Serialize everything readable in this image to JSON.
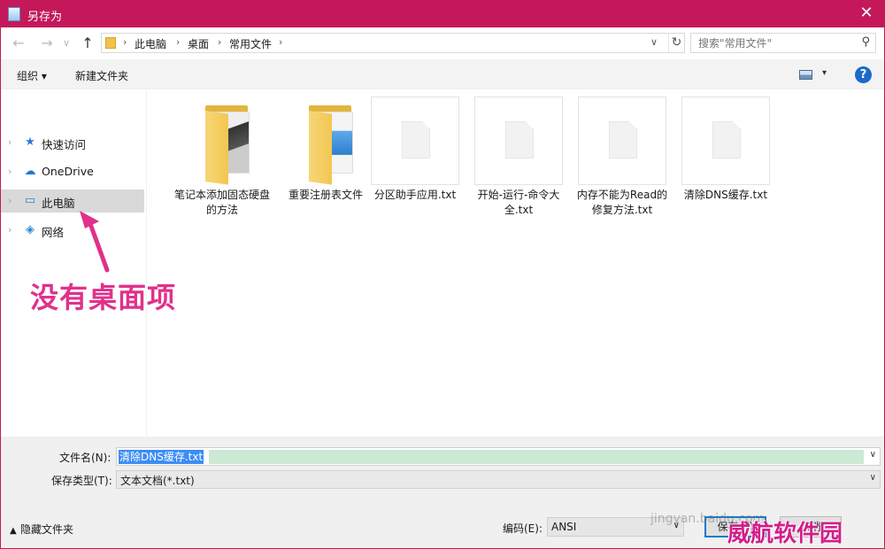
{
  "window": {
    "title": "另存为",
    "close_glyph": "✕"
  },
  "nav": {
    "back_glyph": "←",
    "forward_glyph": "→",
    "recent_glyph": "∨",
    "up_glyph": "↑",
    "breadcrumbs": [
      "此电脑",
      "桌面",
      "常用文件"
    ],
    "sep_glyph": "›",
    "dropdown_glyph": "∨",
    "refresh_glyph": "↻",
    "search_placeholder": "搜索\"常用文件\"",
    "search_glyph": "⚲"
  },
  "commandbar": {
    "organize": "组织 ▾",
    "new_folder": "新建文件夹",
    "view_dd": "▾",
    "help": "?"
  },
  "sidebar": {
    "items": [
      {
        "label": "快速访问",
        "icon": "star-icon",
        "glyph": "★",
        "color": "#2a7bd1",
        "selected": false
      },
      {
        "label": "OneDrive",
        "icon": "cloud-icon",
        "glyph": "☁",
        "color": "#1e7ad6",
        "selected": false
      },
      {
        "label": "此电脑",
        "icon": "computer-icon",
        "glyph": "▭",
        "color": "#2d87d3",
        "selected": true
      },
      {
        "label": "网络",
        "icon": "network-icon",
        "glyph": "◈",
        "color": "#2d87d3",
        "selected": false
      }
    ],
    "chev_glyph": "›"
  },
  "files": [
    {
      "type": "folder",
      "name": "笔记本添加固态硬盘的方法"
    },
    {
      "type": "folder",
      "name": "重要注册表文件"
    },
    {
      "type": "txt",
      "name": "分区助手应用.txt"
    },
    {
      "type": "txt",
      "name": "开始-运行-命令大全.txt"
    },
    {
      "type": "txt",
      "name": "内存不能为Read的修复方法.txt"
    },
    {
      "type": "txt",
      "name": "清除DNS缓存.txt"
    }
  ],
  "bottom": {
    "filename_label": "文件名(N):",
    "filename_value": "清除DNS缓存.txt",
    "filetype_label": "保存类型(T):",
    "filetype_value": "文本文档(*.txt)",
    "hide_folders": "隐藏文件夹",
    "encoding_label": "编码(E):",
    "encoding_value": "ANSI",
    "save_label": "保存(S)",
    "cancel_label": "取消",
    "dd_glyph": "∨"
  },
  "annotation": {
    "text": "没有桌面项"
  },
  "watermarks": {
    "small": "jingyan.baidu.com",
    "brand": "威航软件园"
  },
  "colors": {
    "titlebar": "#c4185a",
    "annotation": "#e0318b",
    "accent": "#1979ca"
  }
}
